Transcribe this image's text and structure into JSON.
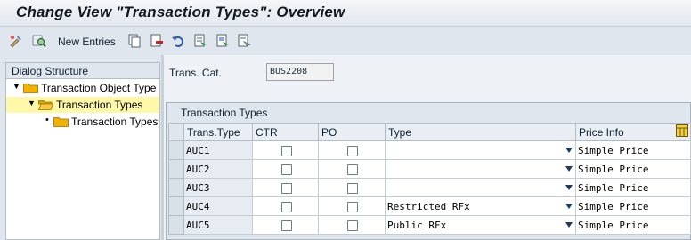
{
  "window": {
    "title": "Change View \"Transaction Types\": Overview"
  },
  "toolbar": {
    "new_entries_label": "New Entries",
    "icons": [
      "display-change-icon",
      "find-icon",
      "copy-icon",
      "delete-icon",
      "undo-icon",
      "select-all-icon",
      "select-block-icon",
      "deselect-all-icon"
    ]
  },
  "dialog_structure": {
    "header": "Dialog Structure",
    "items": [
      {
        "label": "Transaction Object Type",
        "level": 0,
        "expanded": true,
        "selected": false
      },
      {
        "label": "Transaction Types",
        "level": 1,
        "expanded": true,
        "selected": true
      },
      {
        "label": "Transaction Types",
        "level": 2,
        "expanded": false,
        "selected": false
      }
    ]
  },
  "filter": {
    "label": "Trans. Cat.",
    "value": "BUS2208"
  },
  "table": {
    "title": "Transaction Types",
    "columns": [
      "Trans.Type",
      "CTR",
      "PO",
      "Type",
      "Price Info"
    ],
    "rows": [
      {
        "trans_type": "AUC1",
        "ctr": false,
        "po": false,
        "type": "",
        "price_info": "Simple Price"
      },
      {
        "trans_type": "AUC2",
        "ctr": false,
        "po": false,
        "type": "",
        "price_info": "Simple Price"
      },
      {
        "trans_type": "AUC3",
        "ctr": false,
        "po": false,
        "type": "",
        "price_info": "Simple Price"
      },
      {
        "trans_type": "AUC4",
        "ctr": false,
        "po": false,
        "type": "Restricted RFx",
        "price_info": "Simple Price"
      },
      {
        "trans_type": "AUC5",
        "ctr": false,
        "po": false,
        "type": "Public RFx",
        "price_info": "Simple Price"
      }
    ]
  },
  "colors": {
    "tree_selected": "#fff8a8",
    "folder": "#f2b300",
    "background": "#dfe6ee"
  }
}
